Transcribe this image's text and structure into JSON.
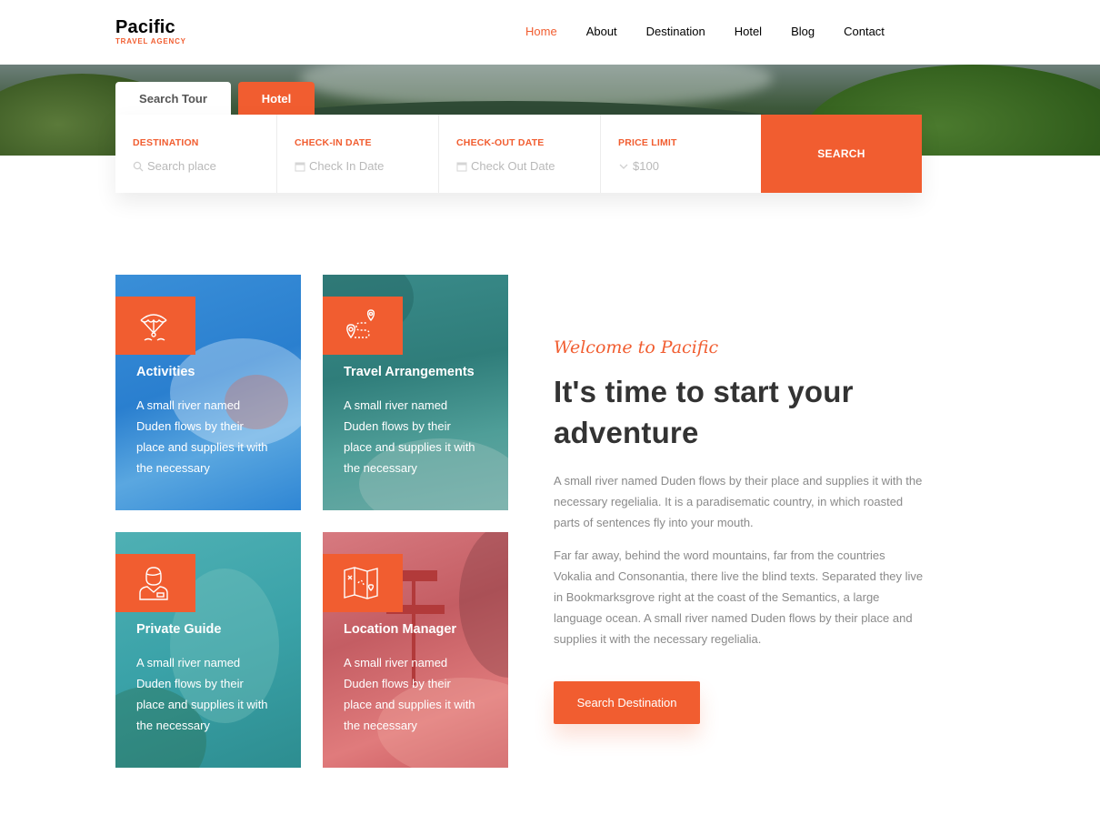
{
  "brand": {
    "name": "Pacific",
    "tagline": "TRAVEL AGENCY"
  },
  "nav": {
    "items": [
      {
        "label": "Home",
        "active": true
      },
      {
        "label": "About"
      },
      {
        "label": "Destination"
      },
      {
        "label": "Hotel"
      },
      {
        "label": "Blog"
      },
      {
        "label": "Contact"
      }
    ]
  },
  "search": {
    "tabs": [
      {
        "label": "Search Tour",
        "active": true
      },
      {
        "label": "Hotel",
        "active": false
      }
    ],
    "fields": [
      {
        "label": "DESTINATION",
        "placeholder": "Search place",
        "icon": "search-icon"
      },
      {
        "label": "CHECK-IN DATE",
        "placeholder": "Check In Date",
        "icon": "calendar-icon"
      },
      {
        "label": "CHECK-OUT DATE",
        "placeholder": "Check Out Date",
        "icon": "calendar-icon"
      },
      {
        "label": "PRICE LIMIT",
        "placeholder": "$100",
        "icon": "chevron-down-icon"
      }
    ],
    "button": "SEARCH"
  },
  "services": [
    {
      "title": "Activities",
      "description": "A small river named Duden flows by their place and supplies it with the necessary",
      "icon": "paragliding-icon"
    },
    {
      "title": "Travel Arrangements",
      "description": "A small river named Duden flows by their place and supplies it with the necessary",
      "icon": "route-map-icon"
    },
    {
      "title": "Private Guide",
      "description": "A small river named Duden flows by their place and supplies it with the necessary",
      "icon": "guide-person-icon"
    },
    {
      "title": "Location Manager",
      "description": "A small river named Duden flows by their place and supplies it with the necessary",
      "icon": "folded-map-icon"
    }
  ],
  "about": {
    "subheading": "Welcome to Pacific",
    "heading": "It's time to start your adventure",
    "paragraph1": "A small river named Duden flows by their place and supplies it with the necessary regelialia. It is a paradisematic country, in which roasted parts of sentences fly into your mouth.",
    "paragraph2": "Far far away, behind the word mountains, far from the countries Vokalia and Consonantia, there live the blind texts. Separated they live in Bookmarksgrove right at the coast of the Semantics, a large language ocean. A small river named Duden flows by their place and supplies it with the necessary regelialia.",
    "button": "Search Destination"
  },
  "colors": {
    "accent": "#f15d30",
    "text": "#333333",
    "muted": "#8a8a8a"
  }
}
